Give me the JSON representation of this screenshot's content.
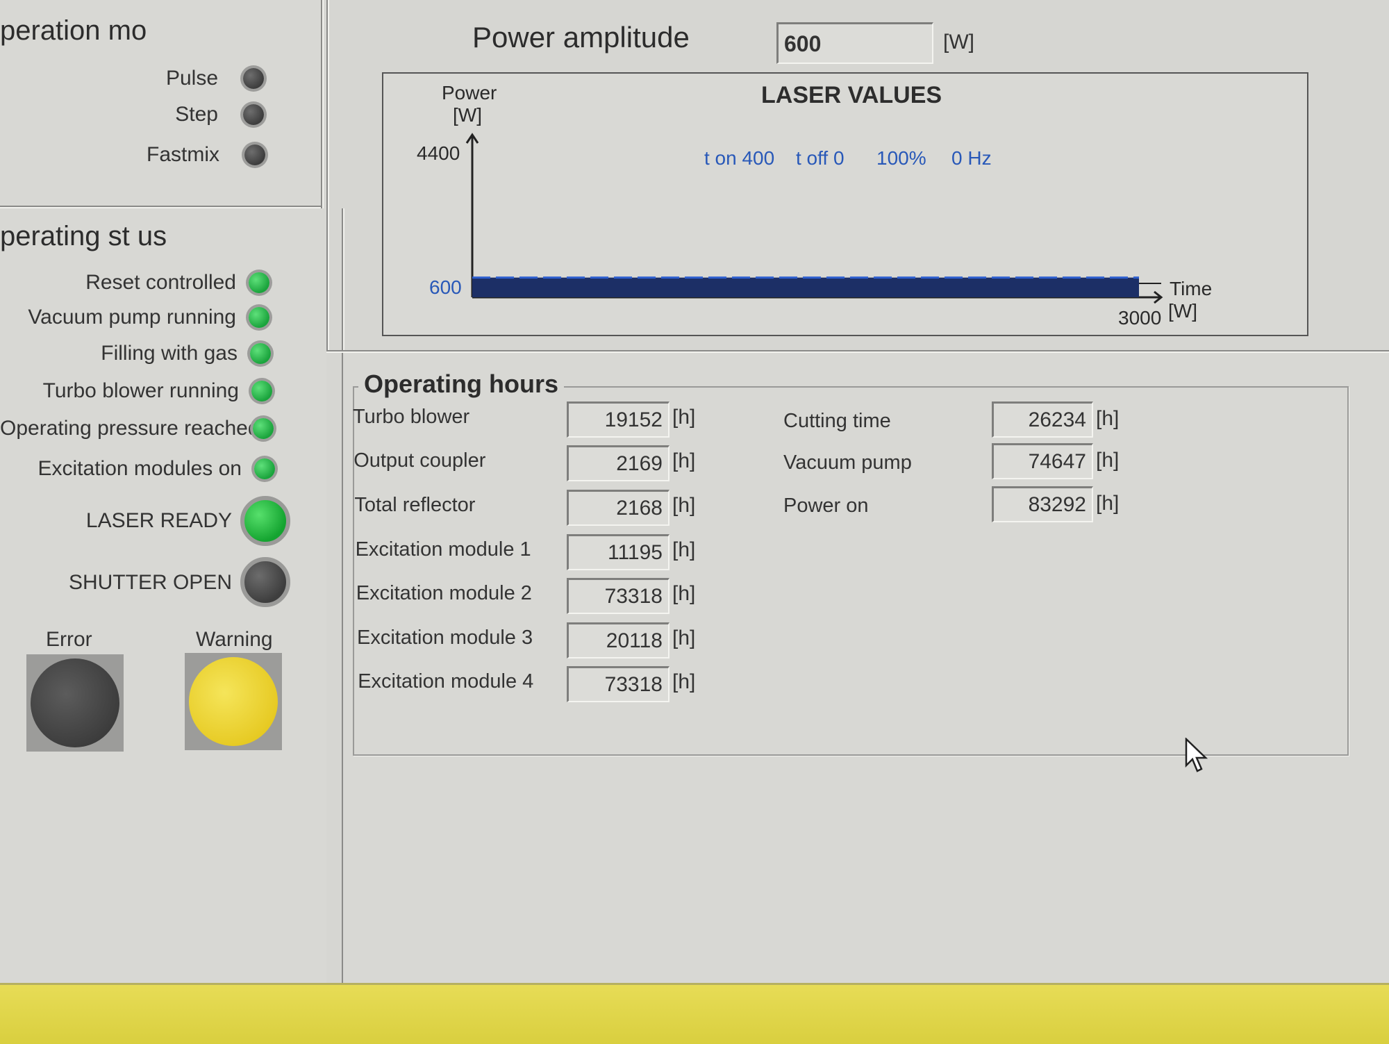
{
  "operation_mode": {
    "title": "peration mo",
    "items": [
      {
        "label": "Pulse",
        "state": "off"
      },
      {
        "label": "Step",
        "state": "off"
      },
      {
        "label": "Fastmix",
        "state": "off"
      }
    ]
  },
  "operating_status": {
    "title": "perating st  us",
    "items": [
      {
        "label": "Reset controlled",
        "state": "on"
      },
      {
        "label": "Vacuum pump running",
        "state": "on"
      },
      {
        "label": "Filling with gas",
        "state": "on"
      },
      {
        "label": "Turbo blower running",
        "state": "on"
      },
      {
        "label": "Operating pressure reached",
        "state": "on"
      },
      {
        "label": "Excitation modules on",
        "state": "on"
      }
    ],
    "laser_ready": {
      "label": "LASER READY",
      "state": "on"
    },
    "shutter_open": {
      "label": "SHUTTER OPEN",
      "state": "off"
    },
    "error": {
      "label": "Error",
      "state": "off"
    },
    "warning": {
      "label": "Warning",
      "state": "on",
      "color": "#e6c921"
    }
  },
  "power": {
    "label": "Power amplitude",
    "value": "600",
    "unit": "[W]"
  },
  "chart": {
    "title": "LASER VALUES",
    "y_label_line1": "Power",
    "y_label_line2": "[W]",
    "y_max_label": "4400",
    "level_label": "600",
    "x_label_line1": "Time",
    "x_label_line2": "[W]",
    "x_max_label": "3000",
    "t_on": "t on 400",
    "t_off": "t off 0",
    "duty": "100%",
    "freq": "0 Hz"
  },
  "chart_data": {
    "type": "line",
    "x": [
      0,
      3000
    ],
    "series": [
      {
        "values": [
          600,
          600
        ]
      }
    ],
    "ylim": [
      0,
      4400
    ],
    "xlim": [
      0,
      3000
    ],
    "grid": false
  },
  "operating_hours": {
    "title": "Operating hours",
    "unit": "[h]",
    "left": [
      {
        "label": "Turbo blower",
        "value": "19152"
      },
      {
        "label": "Output coupler",
        "value": "2169"
      },
      {
        "label": "Total reflector",
        "value": "2168"
      },
      {
        "label": "Excitation module 1",
        "value": "11195"
      },
      {
        "label": "Excitation module 2",
        "value": "73318"
      },
      {
        "label": "Excitation module 3",
        "value": "20118"
      },
      {
        "label": "Excitation module 4",
        "value": "73318"
      }
    ],
    "right": [
      {
        "label": "Cutting time",
        "value": "26234"
      },
      {
        "label": "Vacuum pump",
        "value": "74647"
      },
      {
        "label": "Power on",
        "value": "83292"
      }
    ]
  }
}
